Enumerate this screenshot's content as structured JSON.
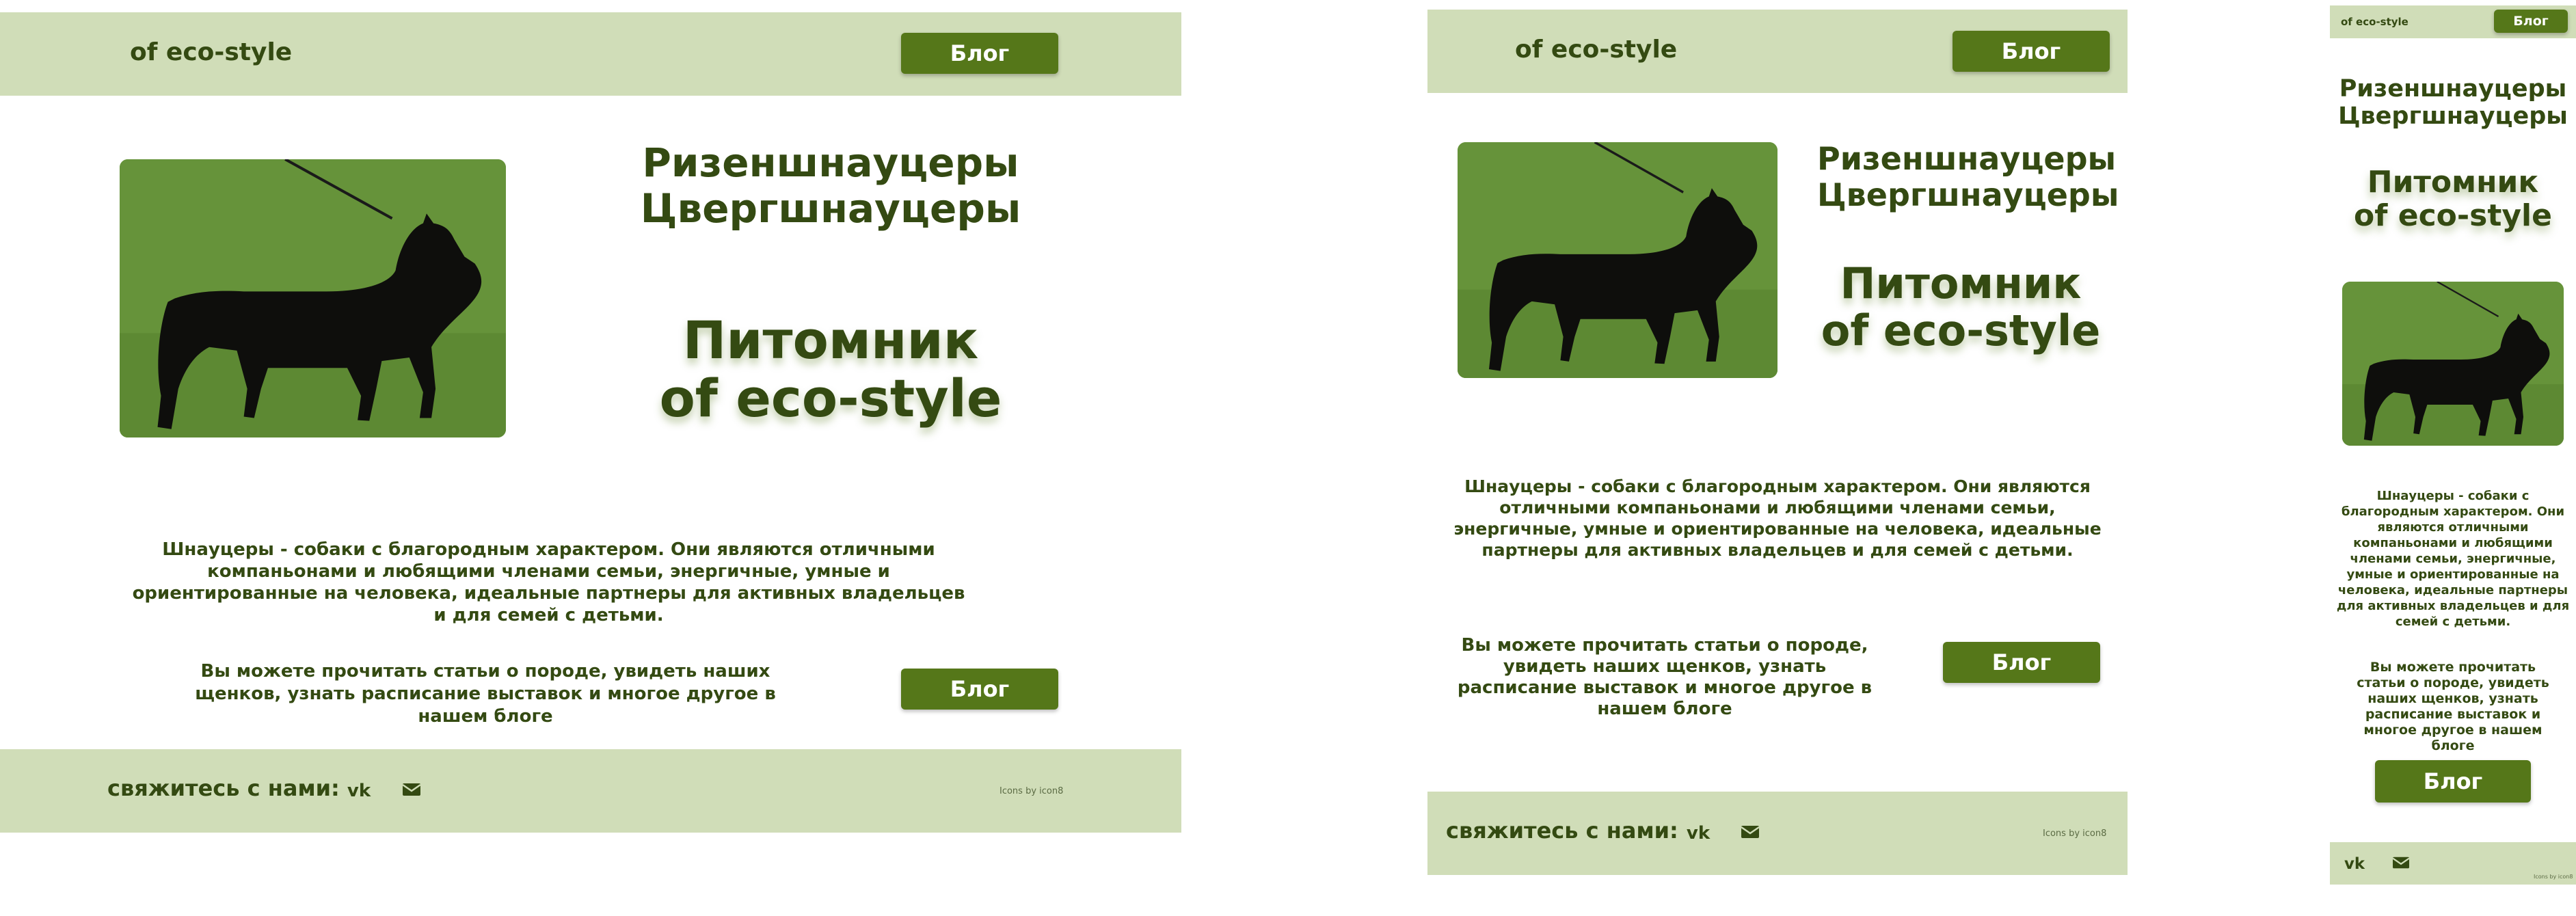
{
  "site": {
    "logo": "of eco-style",
    "blog_label": "Блог",
    "breed_line1": "Ризеншнауцеры",
    "breed_line2": "Цвергшнауцеры",
    "title_line1": "Питомник",
    "title_line2": "of eco-style",
    "about_text": "Шнауцеры - собаки с благородным характером. Они являются отличными компаньонами и любящими членами семьи, энергичные, умные и ориентированные на человека, идеальные партнеры для активных владельцев и для семей с детьми.",
    "blog_text": "Вы можете прочитать статьи о породе,  увидеть наших щенков, узнать расписание выставок и многое другое в нашем блоге",
    "contact_label": "свяжитесь с нами:",
    "credit": "Icons by icon8",
    "colors": {
      "accent": "#557719",
      "bar": "#d0ddb8",
      "text": "#344a12"
    },
    "icons": [
      "vk-icon",
      "mail-icon",
      "dog-photo"
    ]
  }
}
